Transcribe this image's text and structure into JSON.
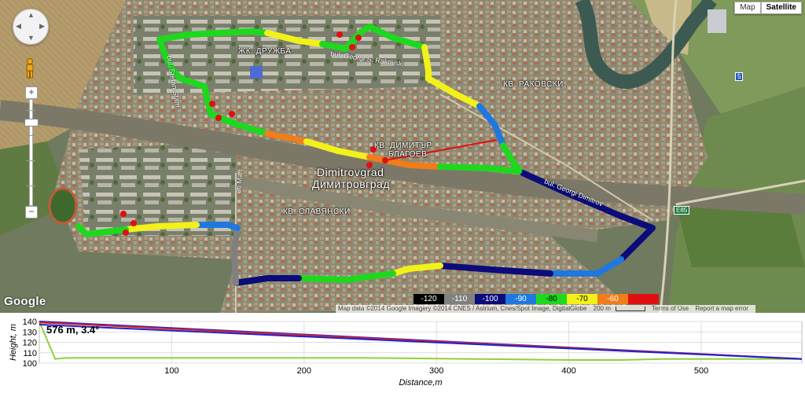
{
  "map_type": {
    "map_label": "Map",
    "satellite_label": "Satellite",
    "active": "satellite"
  },
  "controls": {
    "zoom_in": "+",
    "zoom_out": "−",
    "zoom_level": 0.72
  },
  "places": {
    "druzhba": "ЖК. ДРУЖБА",
    "rakovski": "КВ. РАКОВСКИ",
    "dimitar_blagoev_1": "КВ. ДИМИТЪР",
    "dimitar_blagoev_2": "БЛАГОЕВ",
    "slavyanski": "КВ. СЛАВЯНСКИ",
    "city_latin": "Dimitrovgrad",
    "city_cyrillic": "Димитровград"
  },
  "roads": {
    "rakovski_boulevard": "bul. Georgi S. Rakovski",
    "stamboliyski": "bul. Stefan Stam",
    "march_3": "3ti Mart",
    "bul_georgi_dimitrov": "bul. Georgi Dimitrov"
  },
  "shields": {
    "e85": "E85",
    "i5": "5"
  },
  "google_logo": "Google",
  "legend": {
    "ticks": [
      "-120",
      "-110",
      "-100",
      "-90",
      "-80",
      "-70",
      "-60"
    ],
    "colors": [
      "#000000",
      "#808080",
      "#0b0b7a",
      "#1e78e0",
      "#1ed81e",
      "#f2f21a",
      "#f07d1a",
      "#e01010"
    ]
  },
  "attribution": {
    "imagery": "Map data ©2014 Google Imagery ©2014 CNES / Astrium, Cnes/Spot Image, DigitalGlobe",
    "scale": "200 m",
    "terms": "Terms of Use",
    "report": "Report a map error"
  },
  "profile": {
    "tooltip": "576 m, 3.4°",
    "ylabel": "Height, m",
    "xlabel": "Distance,m",
    "x_ticks": [
      100,
      200,
      300,
      400,
      500
    ],
    "y_ticks": [
      100,
      105,
      110,
      115,
      120,
      125,
      130,
      135,
      140
    ],
    "x_range": [
      0,
      576
    ],
    "y_range": [
      100,
      140
    ],
    "lines": [
      {
        "name": "terrain",
        "color": "#8fd13a",
        "points": [
          [
            0,
            140
          ],
          [
            12,
            104
          ],
          [
            20,
            105
          ],
          [
            120,
            105
          ],
          [
            250,
            105
          ],
          [
            330,
            104
          ],
          [
            400,
            103
          ],
          [
            440,
            103
          ],
          [
            470,
            104
          ],
          [
            500,
            104
          ],
          [
            540,
            104
          ],
          [
            576,
            104
          ]
        ]
      },
      {
        "name": "upper",
        "color": "#2222cc",
        "points": [
          [
            0,
            140
          ],
          [
            576,
            104
          ]
        ]
      },
      {
        "name": "middle",
        "color": "#dd2222",
        "points": [
          [
            0,
            139
          ],
          [
            576,
            104
          ]
        ]
      },
      {
        "name": "lower",
        "color": "#2222cc",
        "points": [
          [
            0,
            137
          ],
          [
            576,
            104
          ]
        ]
      }
    ]
  }
}
